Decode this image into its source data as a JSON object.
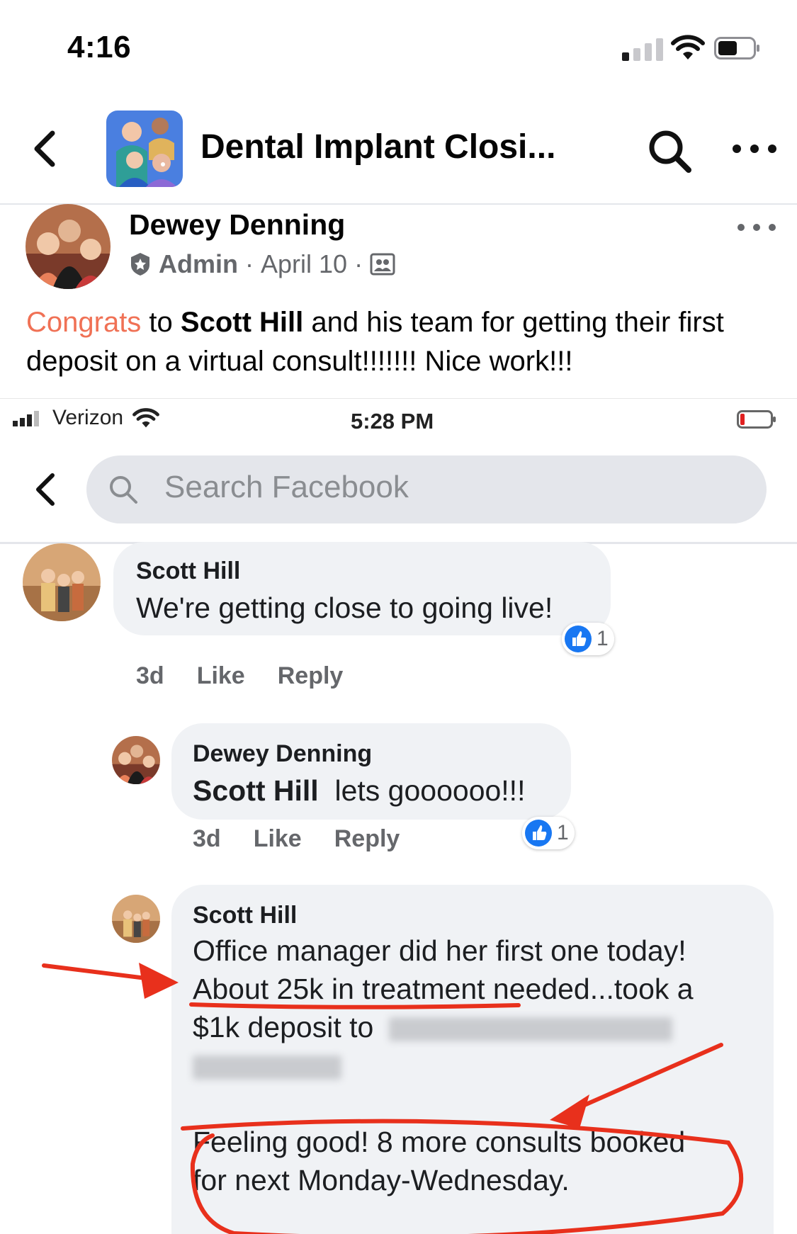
{
  "status_bar": {
    "time": "4:16"
  },
  "header": {
    "group_title": "Dental Implant Closi..."
  },
  "post": {
    "author": "Dewey Denning",
    "role": "Admin",
    "separator": "·",
    "date": "April 10",
    "text_congrats": "Congrats",
    "text_to": " to ",
    "text_mention": "Scott Hill",
    "text_rest": " and his team for getting their first deposit on a virtual consult!!!!!!! Nice work!!!"
  },
  "screenshot": {
    "carrier": "Verizon",
    "time": "5:28 PM",
    "search_placeholder": "Search Facebook",
    "comments": [
      {
        "name": "Scott Hill",
        "text": "We're getting close to going live!",
        "age": "3d",
        "like": "Like",
        "reply": "Reply",
        "reactions": "1"
      },
      {
        "name": "Dewey Denning",
        "mention": "Scott Hill",
        "text": "lets goooooo!!!",
        "age": "3d",
        "like": "Like",
        "reply": "Reply",
        "reactions": "1"
      },
      {
        "name": "Scott Hill",
        "line1": "Office manager did her first one today!",
        "line2": "About 25k in treatment needed...took a",
        "line3": "$1k deposit to",
        "line5": "Feeling good! 8 more consults booked",
        "line6": "for next Monday-Wednesday."
      }
    ]
  },
  "colors": {
    "accent": "#f07155",
    "fb_blue": "#1877f2",
    "annotation_red": "#e8301c"
  }
}
